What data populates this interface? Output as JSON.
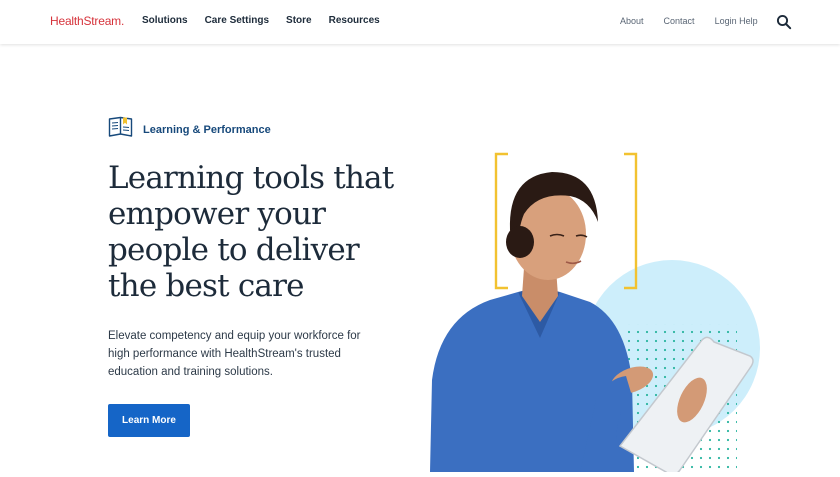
{
  "header": {
    "logo_text": "HealthStream.",
    "nav": [
      "Solutions",
      "Care Settings",
      "Store",
      "Resources"
    ],
    "utility": [
      "About",
      "Contact",
      "Login Help"
    ],
    "search_icon": "search-icon"
  },
  "hero": {
    "eyebrow_icon": "open-book-icon",
    "eyebrow": "Learning & Performance",
    "headline": "Learning tools that empower your people to deliver the best care",
    "subtext": "Elevate competency and equip your workforce for high performance with HealthStream's trusted education and training solutions.",
    "cta": "Learn More"
  },
  "colors": {
    "brand_red": "#d6333b",
    "primary_blue": "#1565c7",
    "eyebrow_blue": "#17497b",
    "accent_yellow": "#f2c230",
    "circle_blue": "#cdeefb",
    "dot_teal": "#2bb5a0"
  }
}
